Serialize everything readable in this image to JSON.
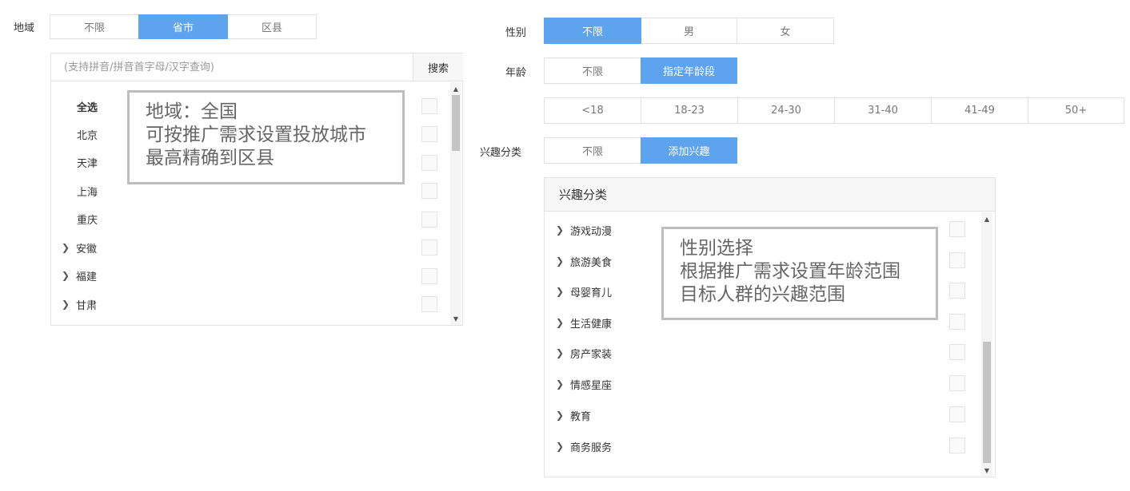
{
  "region": {
    "label": "地域",
    "options": [
      "不限",
      "省市",
      "区县"
    ],
    "selected": "省市",
    "search_placeholder": "(支持拼音/拼音首字母/汉字查询)",
    "search_button": "搜索",
    "items": [
      {
        "label": "全选",
        "expandable": false
      },
      {
        "label": "北京",
        "expandable": false
      },
      {
        "label": "天津",
        "expandable": false
      },
      {
        "label": "上海",
        "expandable": false
      },
      {
        "label": "重庆",
        "expandable": false
      },
      {
        "label": "安徽",
        "expandable": true
      },
      {
        "label": "福建",
        "expandable": true
      },
      {
        "label": "甘肃",
        "expandable": true
      }
    ],
    "tooltip": [
      "地域：全国",
      "可按推广需求设置投放城市",
      "最高精确到区县"
    ]
  },
  "gender": {
    "label": "性别",
    "options": [
      "不限",
      "男",
      "女"
    ],
    "selected": "不限"
  },
  "age": {
    "label": "年龄",
    "options": [
      "不限",
      "指定年龄段"
    ],
    "selected": "指定年龄段",
    "ranges": [
      "<18",
      "18-23",
      "24-30",
      "31-40",
      "41-49",
      "50+"
    ]
  },
  "interest": {
    "label": "兴趣分类",
    "options": [
      "不限",
      "添加兴趣"
    ],
    "selected": "添加兴趣",
    "panel_title": "兴趣分类",
    "items": [
      "游戏动漫",
      "旅游美食",
      "母婴育儿",
      "生活健康",
      "房产家装",
      "情感星座",
      "教育",
      "商务服务"
    ],
    "tooltip": [
      "性别选择",
      "根据推广需求设置年龄范围",
      "目标人群的兴趣范围"
    ]
  },
  "icons": {
    "expand": "chevron-right-icon",
    "scroll_up": "triangle-up-icon",
    "scroll_down": "triangle-down-icon"
  },
  "colors": {
    "accent": "#5ea3ee",
    "border": "#e3e3e3",
    "tooltip_border": "#bdbdbd"
  }
}
